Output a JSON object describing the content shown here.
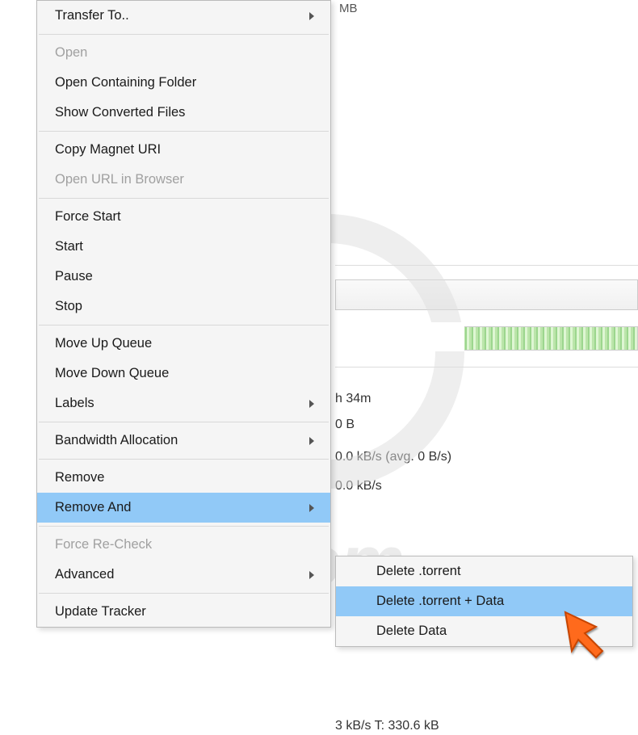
{
  "bg": {
    "top_text": "MB",
    "line1": "h 34m",
    "line2": "0 B",
    "line3": "0.0 kB/s (avg. 0 B/s)",
    "line4": "0.0 kB/s",
    "line5": "3 kB/s T: 330.6 kB"
  },
  "menu": {
    "transfer_to": "Transfer To..",
    "open": "Open",
    "open_containing": "Open Containing Folder",
    "show_converted": "Show Converted Files",
    "copy_magnet": "Copy Magnet URI",
    "open_url": "Open URL in Browser",
    "force_start": "Force Start",
    "start": "Start",
    "pause": "Pause",
    "stop": "Stop",
    "move_up": "Move Up Queue",
    "move_down": "Move Down Queue",
    "labels": "Labels",
    "bandwidth": "Bandwidth Allocation",
    "remove": "Remove",
    "remove_and": "Remove And",
    "force_recheck": "Force Re-Check",
    "advanced": "Advanced",
    "update_tracker": "Update Tracker"
  },
  "submenu": {
    "del_torrent": "Delete .torrent",
    "del_torrent_data": "Delete .torrent + Data",
    "del_data": "Delete Data"
  },
  "watermark": {
    "text": "risk.com"
  }
}
